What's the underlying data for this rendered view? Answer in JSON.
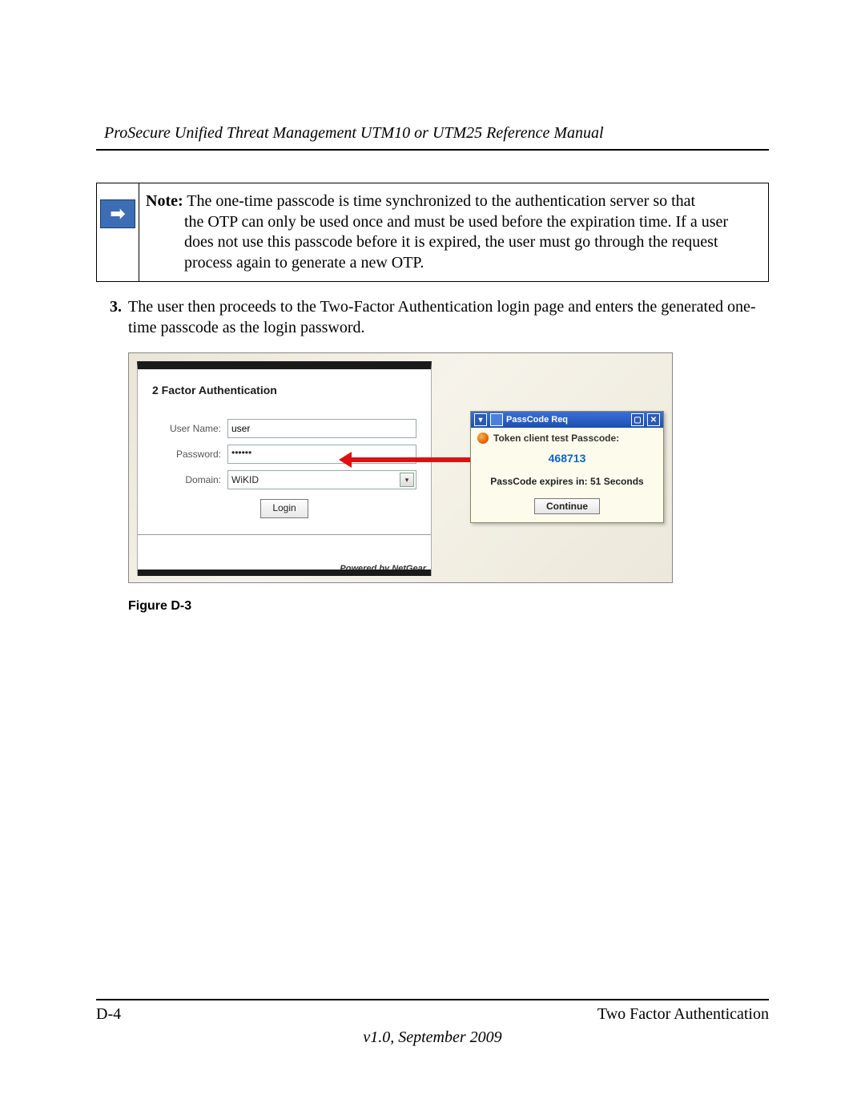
{
  "header": {
    "doc_title": "ProSecure Unified Threat Management UTM10 or UTM25 Reference Manual"
  },
  "note": {
    "label": "Note:",
    "text_first": "The one-time passcode is time synchronized to the authentication server so that",
    "text_rest": "the OTP can only be used once and must be used before the expiration time. If a user does not use this passcode before it is expired, the user must go through the request process again to generate a new OTP.",
    "icon_glyph": "➡"
  },
  "step": {
    "number": "3.",
    "text": "The user then proceeds to the Two-Factor Authentication login page and enters the generated one-time passcode as the login password."
  },
  "login": {
    "title": "2 Factor Authentication",
    "username_label": "User Name:",
    "username_value": "user",
    "password_label": "Password:",
    "password_value": "••••••",
    "domain_label": "Domain:",
    "domain_value": "WiKID",
    "login_button": "Login",
    "powered": "Powered by NetGear"
  },
  "tip": {
    "titlebar": "PassCode Req",
    "line1": "Token client test Passcode:",
    "passcode": "468713",
    "expires_prefix": "PassCode expires in: ",
    "expires_value": "51",
    "expires_suffix": " Seconds",
    "continue": "Continue",
    "dropdown_glyph": "▾",
    "min_glyph": "▢",
    "close_glyph": "✕"
  },
  "figure": {
    "caption": "Figure D-3"
  },
  "footer": {
    "page_num": "D-4",
    "section": "Two Factor Authentication",
    "version": "v1.0, September 2009"
  }
}
